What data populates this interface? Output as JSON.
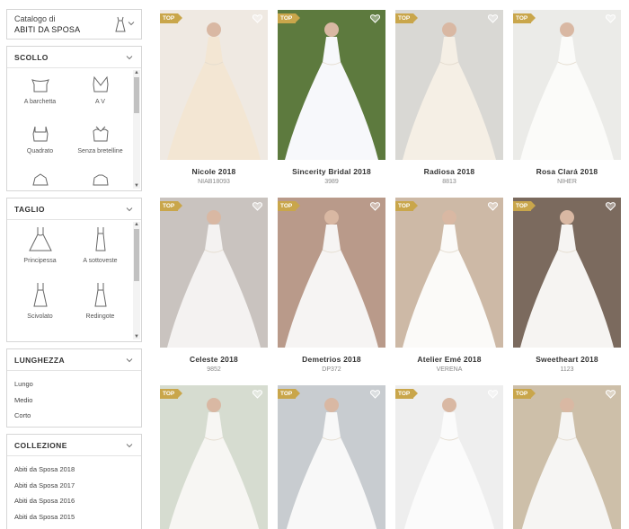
{
  "catalog": {
    "label": "Catalogo di",
    "value": "ABITI DA SPOSA"
  },
  "scollo": {
    "title": "SCOLLO",
    "options": [
      {
        "label": "A barchetta",
        "icon": "bateau-neckline-icon"
      },
      {
        "label": "A V",
        "icon": "v-neckline-icon"
      },
      {
        "label": "Quadrato",
        "icon": "square-neckline-icon"
      },
      {
        "label": "Senza bretelline",
        "icon": "strapless-neckline-icon"
      }
    ]
  },
  "taglio": {
    "title": "TAGLIO",
    "options": [
      {
        "label": "Principessa",
        "icon": "princess-cut-icon"
      },
      {
        "label": "A sottoveste",
        "icon": "slip-cut-icon"
      },
      {
        "label": "Scivolato",
        "icon": "sheath-cut-icon"
      },
      {
        "label": "Redingote",
        "icon": "redingote-cut-icon"
      }
    ]
  },
  "lunghezza": {
    "title": "LUNGHEZZA",
    "options": [
      "Lungo",
      "Medio",
      "Corto"
    ]
  },
  "collezione": {
    "title": "COLLEZIONE",
    "options": [
      "Abiti da Sposa 2018",
      "Abiti da Sposa 2017",
      "Abiti da Sposa 2016",
      "Abiti da Sposa 2015"
    ]
  },
  "badge_label": "TOP",
  "colors": {
    "badge": "#c9a64b",
    "border": "#d6d6d6"
  },
  "products": [
    {
      "name": "Nicole 2018",
      "code": "NIAB18093",
      "bg": "#efe9e2",
      "dress": "#f3e6d3"
    },
    {
      "name": "Sincerity Bridal 2018",
      "code": "3989",
      "bg": "#5d7a3e",
      "dress": "#f7f8fb"
    },
    {
      "name": "Radiosa 2018",
      "code": "8813",
      "bg": "#d9d8d4",
      "dress": "#f5efe5"
    },
    {
      "name": "Rosa Clará 2018",
      "code": "NIHER",
      "bg": "#ebebe8",
      "dress": "#fbfbf9"
    },
    {
      "name": "Celeste 2018",
      "code": "9852",
      "bg": "#c9c3bf",
      "dress": "#f4f2f1"
    },
    {
      "name": "Demetrios 2018",
      "code": "DP372",
      "bg": "#b99a8a",
      "dress": "#f6f4f3"
    },
    {
      "name": "Atelier Emé 2018",
      "code": "VERENA",
      "bg": "#cdb9a6",
      "dress": "#fbfaf8"
    },
    {
      "name": "Sweetheart 2018",
      "code": "1123",
      "bg": "#7b6a5e",
      "dress": "#f6f4f2"
    },
    {
      "name": "",
      "code": "",
      "bg": "#d6dcd0",
      "dress": "#f7f6f3"
    },
    {
      "name": "",
      "code": "",
      "bg": "#c8ccd0",
      "dress": "#f8f8f8"
    },
    {
      "name": "",
      "code": "",
      "bg": "#eeeeee",
      "dress": "#fbfbfb"
    },
    {
      "name": "",
      "code": "",
      "bg": "#cdbfa9",
      "dress": "#f6f5f3"
    }
  ]
}
